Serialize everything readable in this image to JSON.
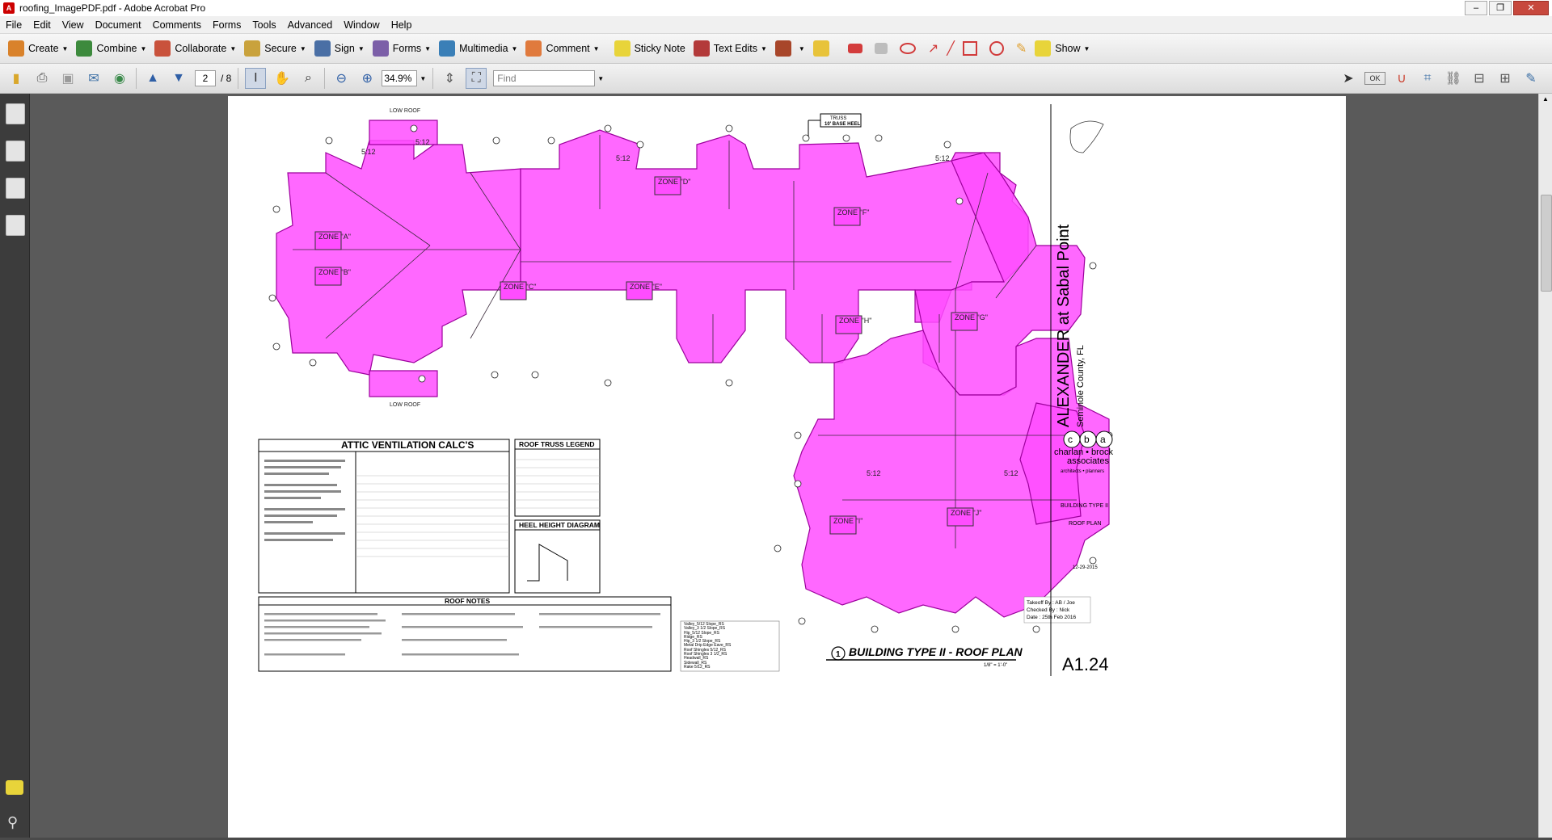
{
  "window": {
    "title": "roofing_ImagePDF.pdf - Adobe Acrobat Pro",
    "min": "–",
    "max": "❐",
    "close": "✕"
  },
  "menu": [
    "File",
    "Edit",
    "View",
    "Document",
    "Comments",
    "Forms",
    "Tools",
    "Advanced",
    "Window",
    "Help"
  ],
  "toolbar1": [
    {
      "label": "Create",
      "color": "#d9822b"
    },
    {
      "label": "Combine",
      "color": "#3d8a3d"
    },
    {
      "label": "Collaborate",
      "color": "#c9523c"
    },
    {
      "label": "Secure",
      "color": "#c9a23c"
    },
    {
      "label": "Sign",
      "color": "#4a6fa5"
    },
    {
      "label": "Forms",
      "color": "#7c5fa8"
    },
    {
      "label": "Multimedia",
      "color": "#3a7fb7"
    },
    {
      "label": "Comment",
      "color": "#e07a3d"
    },
    {
      "label": "Sticky Note",
      "color": "#e8d43a"
    },
    {
      "label": "Text Edits",
      "color": "#b33a3a"
    },
    {
      "label": "Show",
      "color": "#e8d43a"
    }
  ],
  "nav": {
    "page": "2",
    "of": "/ 8",
    "zoom": "34.9%",
    "find": "Find"
  },
  "sheet": {
    "project": "ALEXANDER at Sabal Point",
    "county": "Seminole County, FL",
    "firm1": "charlan • brock",
    "firm2": "associates",
    "firm3": "architects  •  planners",
    "bldg": "BUILDING TYPE II",
    "plan": "ROOF PLAN",
    "date": "12-29-2015",
    "sheetno": "A1.24",
    "drawing_title": "BUILDING TYPE II - ROOF PLAN",
    "scale": "1/8\" = 1'-0\"",
    "takeoff": "Takeoff By : AB / Joe",
    "checked": "Checked By : Nick",
    "tdate": "Date : 25th Feb 2016",
    "truss_note1": "TRUSS",
    "truss_note2": "10' BASE HEEL",
    "low_roof_top": "LOW ROOF",
    "low_roof_bot": "LOW ROOF",
    "zones": [
      "ZONE \"A\"",
      "ZONE \"B\"",
      "ZONE \"C\"",
      "ZONE \"D\"",
      "ZONE \"E\"",
      "ZONE \"F\"",
      "ZONE \"G\"",
      "ZONE \"H\"",
      "ZONE \"I\"",
      "ZONE \"J\""
    ],
    "attic_title": "ATTIC VENTILATION CALC'S",
    "truss_legend": "ROOF TRUSS LEGEND",
    "heel_diagram": "HEEL HEIGHT DIAGRAM",
    "roof_notes": "ROOF NOTES",
    "slope": "5:12"
  },
  "legend_items": [
    "Valley_5/12 Slope_RS",
    "Valley_3 1/2 Slope_RS",
    "Hip_5/12 Slope_RS",
    "Ridge_RS",
    "Hip_3 1/2 Slope_RS",
    "Metal Drip Edge Eave_RS",
    "Roof Shingles 5/12_RS",
    "Roof Shingles 3 1/2_RS",
    "Headwall_RS",
    "Sidewall_RS",
    "Rake 5/12_RS"
  ],
  "colors": {
    "roof": "#ff4dff",
    "roofStroke": "#b000b0"
  }
}
